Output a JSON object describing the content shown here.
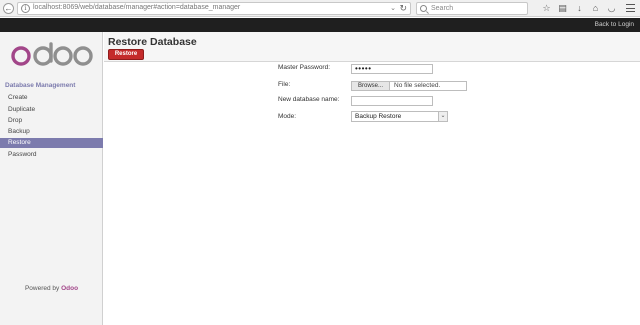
{
  "browser": {
    "url": "localhost:8069/web/database/manager#action=database_manager",
    "search_placeholder": "Search",
    "icons": {
      "back": "arrow-left",
      "info": "info-circle",
      "dropdown": "chevron-down",
      "reload": "reload",
      "star": "star",
      "reading_list": "clipboard",
      "downloads": "arrow-down",
      "home": "home",
      "pocket": "pocket",
      "menu": "hamburger"
    },
    "glyphs": {
      "back": "←",
      "info": "i",
      "dropdown": "⌄",
      "reload": "↻",
      "star": "☆",
      "reading_list": "▤",
      "downloads": "↓",
      "home": "⌂",
      "pocket": "◡"
    }
  },
  "topbar": {
    "back_to_login": "Back to Login"
  },
  "sidebar": {
    "logo_text": "odoo",
    "heading": "Database Management",
    "items": [
      {
        "label": "Create"
      },
      {
        "label": "Duplicate"
      },
      {
        "label": "Drop"
      },
      {
        "label": "Backup"
      },
      {
        "label": "Restore",
        "active": true
      },
      {
        "label": "Password"
      }
    ],
    "powered_by": "Powered by",
    "powered_brand": "Odoo"
  },
  "main": {
    "title": "Restore Database",
    "restore_button": "Restore",
    "form": {
      "master_password_label": "Master Password:",
      "master_password_value": "•••••",
      "file_label": "File:",
      "browse_label": "Browse...",
      "file_status": "No file selected.",
      "new_db_label": "New database name:",
      "new_db_value": "",
      "mode_label": "Mode:",
      "mode_value": "Backup Restore"
    }
  },
  "colors": {
    "accent": "#7c7bad",
    "button_red": "#c42b2b",
    "topbar": "#1f1f1f",
    "logo_purple": "#a24689",
    "logo_gray": "#8f8f8f"
  }
}
